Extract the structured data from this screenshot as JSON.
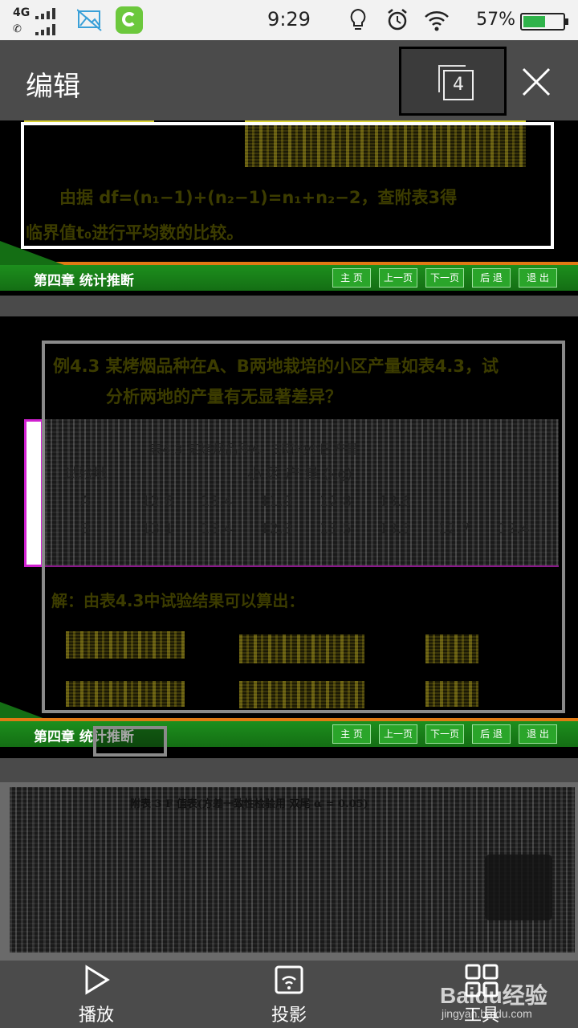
{
  "status_bar": {
    "network": "4G",
    "time": "9:29",
    "battery": "57%",
    "battery_level": 0.57
  },
  "header": {
    "title": "编辑",
    "page_count": "4"
  },
  "slides": {
    "chapter_label": "第四章  统计推断",
    "nav": [
      "主 页",
      "上一页",
      "下一页",
      "后 退",
      "退 出"
    ],
    "slide1_line1": "由据 df=(n₁−1)+(n₂−1)=n₁+n₂−2，查附表3得",
    "slide1_line2": "临界值t₀进行平均数的比较。",
    "slide2_title1": "例4.3 某烤烟品种在A、B两地栽培的小区产量如表4.3，试",
    "slide2_title2": "分析两地的产量有无显著差异？",
    "slide2_table_caption": "表4.3  某烤烟品种A、B两地小区产量",
    "slide2_col_site": "试验地",
    "slide2_col_yield": "小  区  产  量  (kg)",
    "slide2_row_a": [
      "A",
      "12.6",
      "13.4",
      "11.9",
      "12.8",
      "13.6"
    ],
    "slide2_row_b": [
      "B",
      "13.1",
      "13.4",
      "12.8",
      "13.5",
      "13.5",
      "12.7",
      "12.4"
    ],
    "slide2_solution": "解：由表4.3中试验结果可以算出：",
    "slide3_title": "附表 3   F 值表(方差一致性检验用  双尾 α = 0.05)"
  },
  "toolbar": {
    "play": "播放",
    "project": "投影",
    "tools": "工具"
  },
  "watermark": {
    "main": "Baidu经验",
    "sub": "jingyan.baidu.com"
  },
  "colors": {
    "header_bg": "#4b4b4b",
    "chapter_green": "#1d8f1d",
    "accent_orange": "#e07a14",
    "battery_green": "#2fb34a"
  }
}
